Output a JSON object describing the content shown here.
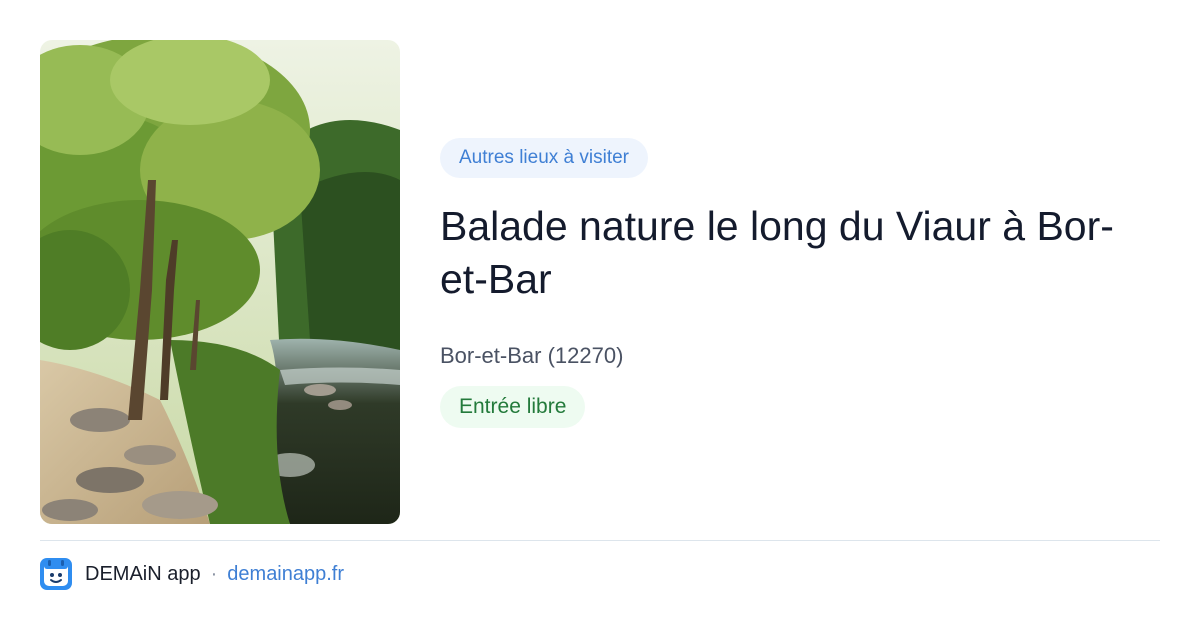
{
  "category": "Autres lieux à visiter",
  "title": "Balade nature le long du Viaur à Bor-et-Bar",
  "location": "Bor-et-Bar (12270)",
  "entry": "Entrée libre",
  "footer": {
    "app_name": "DEMAiN app",
    "separator": "·",
    "domain": "demainapp.fr",
    "app_icon": "demain-app-icon"
  },
  "photo": {
    "subject": "river-forest-photo"
  },
  "colors": {
    "accent_blue": "#3f7fd4",
    "category_bg": "#eef4fd",
    "entry_green": "#237a3b",
    "entry_bg": "#eefbf1",
    "title_text": "#141b2d"
  }
}
